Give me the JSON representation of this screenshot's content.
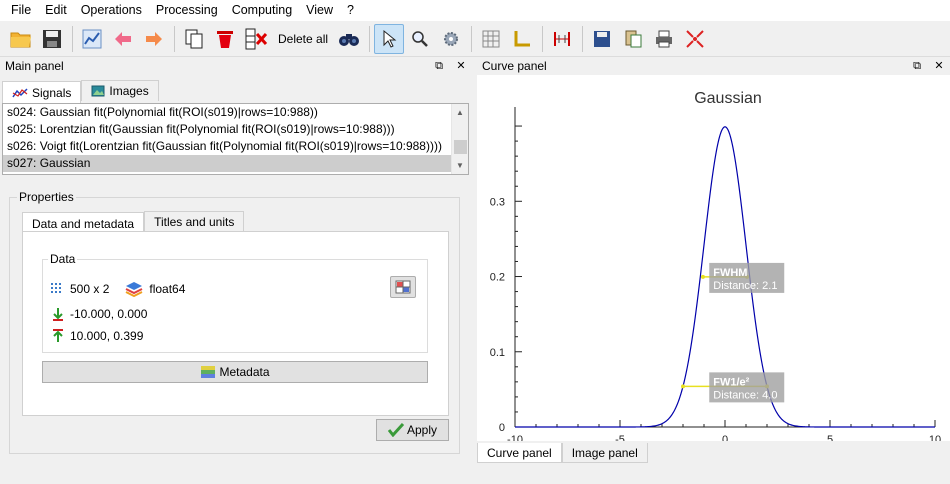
{
  "menu": [
    "File",
    "Edit",
    "Operations",
    "Processing",
    "Computing",
    "View",
    "?"
  ],
  "toolbar": {
    "delete_all": "Delete all"
  },
  "main_panel": {
    "title": "Main panel",
    "tabs": [
      "Signals",
      "Images"
    ],
    "signals": [
      "s024: Gaussian fit(Polynomial fit(ROI(s019)|rows=10:988))",
      "s025: Lorentzian fit(Gaussian fit(Polynomial fit(ROI(s019)|rows=10:988)))",
      "s026: Voigt fit(Lorentzian fit(Gaussian fit(Polynomial fit(ROI(s019)|rows=10:988))))",
      "s027: Gaussian"
    ],
    "properties": {
      "legend": "Properties",
      "tabs": [
        "Data and metadata",
        "Titles and units"
      ],
      "data_legend": "Data",
      "size": "500 x 2",
      "dtype": "float64",
      "min": "-10.000, 0.000",
      "max": "10.000, 0.399",
      "metadata_button": "Metadata",
      "apply_button": "Apply"
    }
  },
  "curve_panel": {
    "title": "Curve panel",
    "bottom_tabs": [
      "Curve panel",
      "Image panel"
    ]
  },
  "chart_data": {
    "type": "line",
    "title": "Gaussian",
    "xlabel": "",
    "ylabel": "",
    "xlim": [
      -10,
      10
    ],
    "ylim": [
      0,
      0.42
    ],
    "x_ticks": [
      -10,
      -5,
      0,
      5,
      10
    ],
    "y_ticks": [
      0,
      0.1,
      0.2,
      0.3
    ],
    "y_tick_labels": [
      "0",
      "0.1",
      "0.2",
      "0.3"
    ],
    "grid": false,
    "series": [
      {
        "function": "gaussian",
        "mu": 0,
        "sigma": 1,
        "amplitude": 0.399,
        "x_range": [
          -10,
          10
        ],
        "points": 500,
        "color": "#0000aa"
      }
    ],
    "annotations": [
      {
        "label": "FWHM",
        "detail": "Distance: 2.1",
        "x_range": [
          -1.05,
          1.05
        ],
        "y": 0.1995
      },
      {
        "label": "FW1/e²",
        "detail": "Distance: 4.0",
        "x_range": [
          -2.0,
          2.0
        ],
        "y": 0.054
      }
    ]
  }
}
